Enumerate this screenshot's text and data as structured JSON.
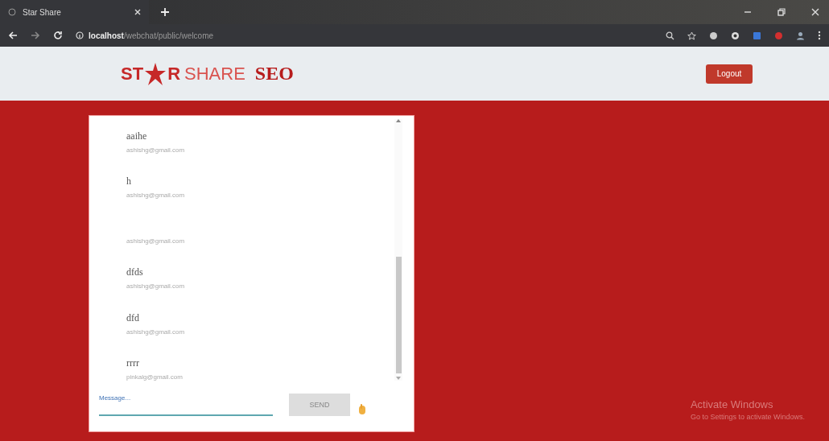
{
  "browser": {
    "tab_title": "Star Share",
    "url_host": "localhost",
    "url_path": "/webchat/public/welcome"
  },
  "header": {
    "logo_left": "ST",
    "logo_right": "R",
    "logo_share": "SHARE",
    "logo_seo": "SEO",
    "logout": "Logout"
  },
  "messages": [
    {
      "name": "aaihe",
      "email": "ashishg@gmail.com"
    },
    {
      "name": "h",
      "email": "ashishg@gmail.com"
    },
    {
      "email": "ashishg@gmail.com"
    },
    {
      "name": "dfds",
      "email": "ashishg@gmail.com"
    },
    {
      "name": "dfd",
      "email": "ashishg@gmail.com"
    },
    {
      "name": "rrrr",
      "email": "pinkalg@gmail.com"
    }
  ],
  "composer": {
    "label": "Message...",
    "send": "SEND",
    "send_disabled": true
  },
  "os_notice": {
    "title": "Activate Windows",
    "text": "Go to Settings to activate Windows."
  }
}
